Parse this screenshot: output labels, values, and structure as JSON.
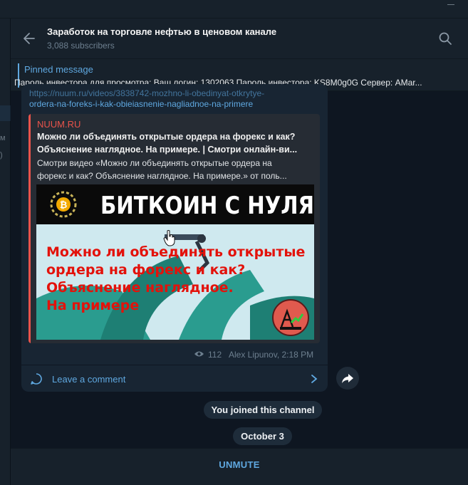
{
  "header": {
    "title": "Заработок на торговле нефтью в ценовом канале",
    "subscribers": "3,088 subscribers"
  },
  "pinned": {
    "label": "Pinned message",
    "text": "Пароль инвестора для просмотра:  Ваш логин: 1302063 Пароль инвестора: KS8M0g0G Сервер: AMar..."
  },
  "message": {
    "link_fragment": "https://nuum.ru/videos/3838742-mozhno-li-obedinyat-otkrytye-",
    "link_line": "ordera-na-foreks-i-kak-obieiasnenie-nagliadnoe-na-primere",
    "preview": {
      "site": "NUUM.RU",
      "title_line1": "Можно ли объединять открытые ордера на форекс и как?",
      "title_line2": "Объяснение наглядное. На примере. | Смотри онлайн-ви...",
      "desc_line1": "Смотри видео «Можно ли объединять открытые ордера на",
      "desc_line2": "форекс и как? Объяснение наглядное. На примере.» от поль...",
      "thumbnail": {
        "banner": "БИТКОИН С НУЛЯ",
        "line1": "Можно ли объединять открытые",
        "line2": "ордера на форекс и как?",
        "line3": "Объяснение наглядное.",
        "line4": "На примере"
      }
    },
    "views": "112",
    "author_time": "Alex Lipunov, 2:18 PM",
    "comment_label": "Leave a comment"
  },
  "service": {
    "joined": "You joined this channel",
    "date": "October 3"
  },
  "bottom": {
    "unmute": "UNMUTE"
  },
  "icons": [
    "back-arrow-icon",
    "search-icon",
    "eye-icon",
    "comment-icon",
    "chevron-right-icon",
    "share-icon",
    "hand-cursor-icon",
    "bitcoin-logo-icon",
    "oil-rig-logo-icon"
  ],
  "colors": {
    "background": "#0e1621",
    "panel": "#17212b",
    "bubble": "#182533",
    "accent": "#5fa8e0",
    "preview_bar": "#e8534b",
    "thumbnail_text": "#e3120b"
  }
}
